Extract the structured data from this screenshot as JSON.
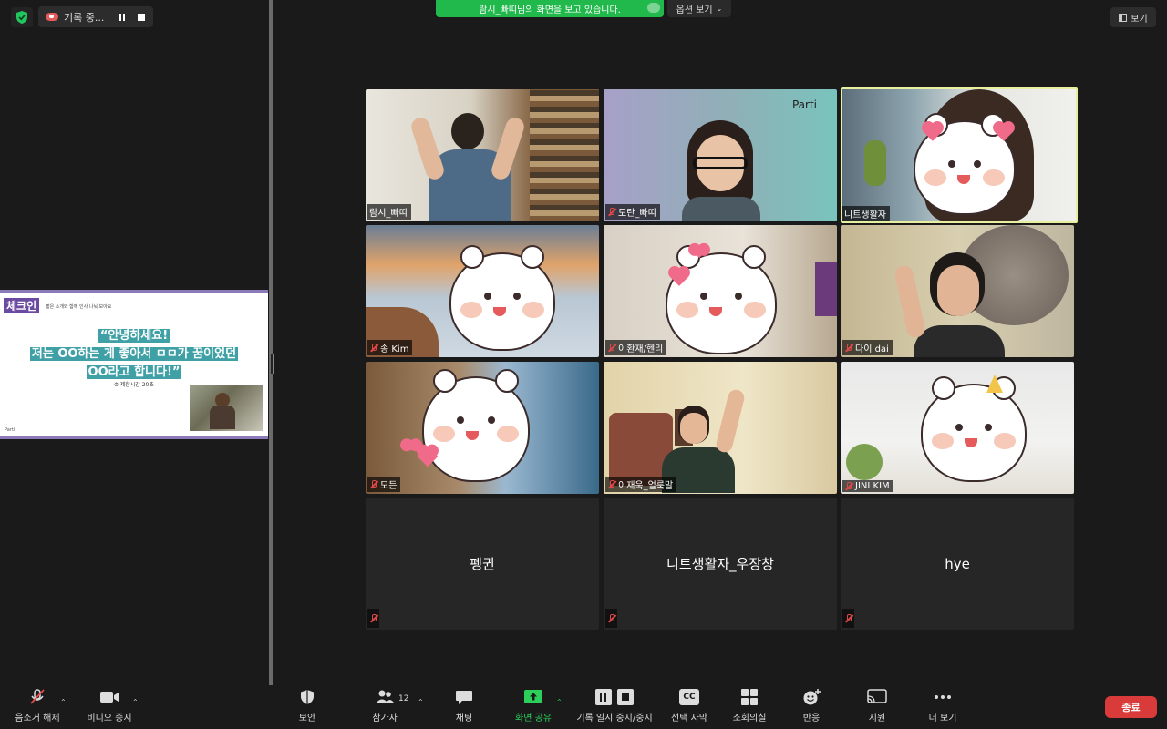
{
  "topbar": {
    "recording_label": "기록 중...",
    "banner_text": "람시_빠띠님의 화면을 보고 있습니다.",
    "view_options": "옵션 보기",
    "view_button": "보기"
  },
  "slide": {
    "tag": "체크인",
    "subtitle": "짧은 소개와 함께 인사 나눠 보아요",
    "line1": "“안녕하세요!",
    "line2": "저는 OO하는 게 좋아서 ㅁㅁ가 꿈이었던",
    "line3": "OO라고 합니다!”",
    "note": "제한시간 20초",
    "logo": "Parti"
  },
  "participants": [
    {
      "name": "람시_빠띠",
      "muted": false
    },
    {
      "name": "도란_빠띠",
      "muted": true
    },
    {
      "name": "니트생활자",
      "muted": false
    },
    {
      "name": "송 Kim",
      "muted": true
    },
    {
      "name": "이환재/헨리",
      "muted": true
    },
    {
      "name": "다이 dai",
      "muted": true
    },
    {
      "name": "모든",
      "muted": true
    },
    {
      "name": "이재욱_얼룩말",
      "muted": true
    },
    {
      "name": "JINI KIM",
      "muted": true
    },
    {
      "name": "펭귄",
      "muted": true
    },
    {
      "name": "니트생활자_우장창",
      "muted": true
    },
    {
      "name": "hye",
      "muted": true
    }
  ],
  "tile2_brand": "Parti",
  "toolbar": {
    "unmute": "음소거 해제",
    "stop_video": "비디오 중지",
    "security": "보안",
    "participants": "참가자",
    "participants_count": "12",
    "chat": "채팅",
    "share_screen": "화면 공유",
    "record_pause": "기록 일시 중지/중지",
    "captions": "선택 자막",
    "cc": "CC",
    "breakout": "소회의실",
    "reactions": "반응",
    "support": "지원",
    "more": "더 보기",
    "end": "종료"
  },
  "colors": {
    "share_banner": "#21b84c",
    "end_button": "#d93b3b",
    "active_speaker": "#e8f0a0",
    "share_icon": "#2bd05b"
  }
}
